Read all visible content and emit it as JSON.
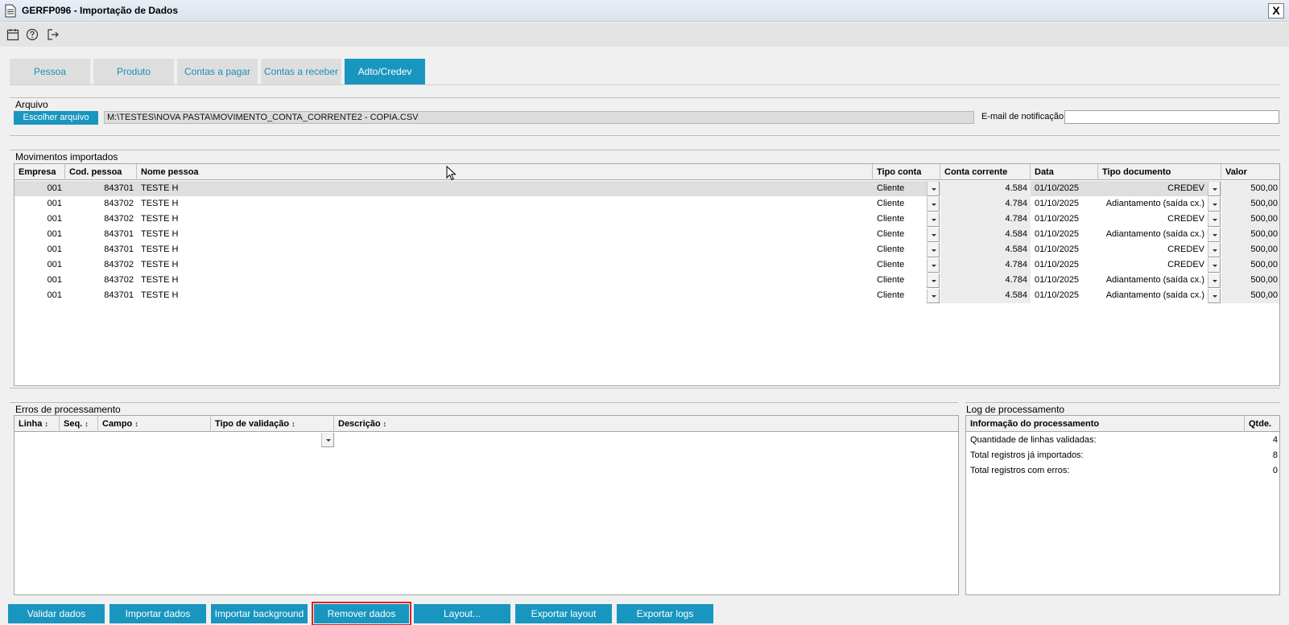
{
  "window": {
    "title": "GERFP096 - Importação de Dados",
    "close_label": "X"
  },
  "toolbar": {
    "icons": [
      "calendar-icon",
      "help-icon",
      "exit-icon"
    ]
  },
  "tabs": [
    {
      "label": "Pessoa",
      "active": false
    },
    {
      "label": "Produto",
      "active": false
    },
    {
      "label": "Contas a pagar",
      "active": false
    },
    {
      "label": "Contas a receber",
      "active": false
    },
    {
      "label": "Adto/Credev",
      "active": true
    }
  ],
  "file": {
    "section_label": "Arquivo",
    "choose_button": "Escolher arquivo",
    "path": "M:\\TESTES\\NOVA PASTA\\MOVIMENTO_CONTA_CORRENTE2 - COPIA.CSV",
    "email_label": "E-mail de notificação",
    "email_value": ""
  },
  "movements": {
    "section_label": "Movimentos importados",
    "columns": [
      "Empresa",
      "Cod. pessoa",
      "Nome pessoa",
      "Tipo conta",
      "Conta corrente",
      "Data",
      "Tipo documento",
      "Valor"
    ],
    "rows": [
      {
        "empresa": "001",
        "cod": "843701",
        "nome": "TESTE H",
        "tipo_conta": "Cliente",
        "conta": "4.584",
        "data": "01/10/2025",
        "tipo_doc": "CREDEV",
        "valor": "500,00"
      },
      {
        "empresa": "001",
        "cod": "843702",
        "nome": "TESTE H",
        "tipo_conta": "Cliente",
        "conta": "4.784",
        "data": "01/10/2025",
        "tipo_doc": "Adiantamento (saída cx.)",
        "valor": "500,00"
      },
      {
        "empresa": "001",
        "cod": "843702",
        "nome": "TESTE H",
        "tipo_conta": "Cliente",
        "conta": "4.784",
        "data": "01/10/2025",
        "tipo_doc": "CREDEV",
        "valor": "500,00"
      },
      {
        "empresa": "001",
        "cod": "843701",
        "nome": "TESTE H",
        "tipo_conta": "Cliente",
        "conta": "4.584",
        "data": "01/10/2025",
        "tipo_doc": "Adiantamento (saída cx.)",
        "valor": "500,00"
      },
      {
        "empresa": "001",
        "cod": "843701",
        "nome": "TESTE H",
        "tipo_conta": "Cliente",
        "conta": "4.584",
        "data": "01/10/2025",
        "tipo_doc": "CREDEV",
        "valor": "500,00"
      },
      {
        "empresa": "001",
        "cod": "843702",
        "nome": "TESTE H",
        "tipo_conta": "Cliente",
        "conta": "4.784",
        "data": "01/10/2025",
        "tipo_doc": "CREDEV",
        "valor": "500,00"
      },
      {
        "empresa": "001",
        "cod": "843702",
        "nome": "TESTE H",
        "tipo_conta": "Cliente",
        "conta": "4.784",
        "data": "01/10/2025",
        "tipo_doc": "Adiantamento (saída cx.)",
        "valor": "500,00"
      },
      {
        "empresa": "001",
        "cod": "843701",
        "nome": "TESTE H",
        "tipo_conta": "Cliente",
        "conta": "4.584",
        "data": "01/10/2025",
        "tipo_doc": "Adiantamento (saída cx.)",
        "valor": "500,00"
      }
    ]
  },
  "errors": {
    "section_label": "Erros de processamento",
    "columns": [
      "Linha",
      "Seq.",
      "Campo",
      "Tipo de validação",
      "Descrição"
    ]
  },
  "log": {
    "section_label": "Log de processamento",
    "columns": [
      "Informação do processamento",
      "Qtde."
    ],
    "rows": [
      {
        "info": "Quantidade de linhas validadas:",
        "qtde": "4"
      },
      {
        "info": "Total registros já importados:",
        "qtde": "8"
      },
      {
        "info": "Total registros com erros:",
        "qtde": "0"
      }
    ]
  },
  "buttons": {
    "validate": "Validar dados",
    "import": "Importar dados",
    "import_background": "Importar background",
    "remove": "Remover dados",
    "layout": "Layout...",
    "export_layout": "Exportar layout",
    "export_logs": "Exportar logs"
  },
  "colors": {
    "accent": "#1996bf",
    "highlight_border": "#e0202a"
  }
}
